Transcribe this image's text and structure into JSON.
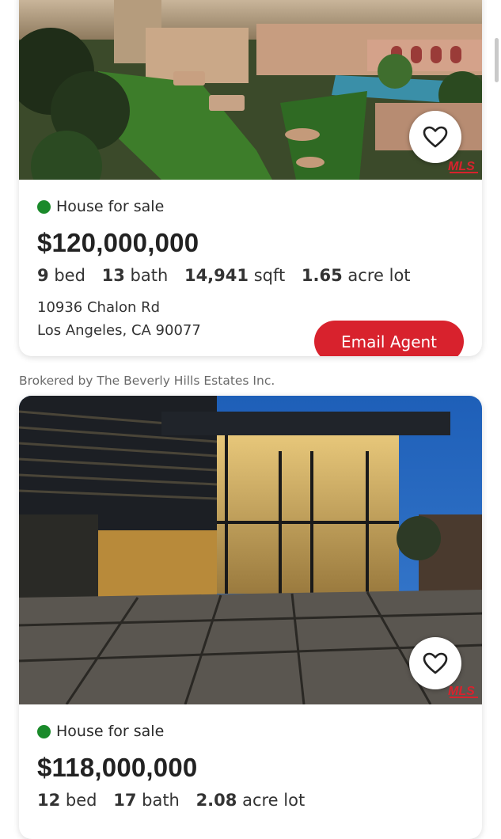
{
  "listings": [
    {
      "status": "House for sale",
      "price": "$120,000,000",
      "specs": [
        {
          "value": "9",
          "unit": "bed"
        },
        {
          "value": "13",
          "unit": "bath"
        },
        {
          "value": "14,941",
          "unit": "sqft"
        },
        {
          "value": "1.65",
          "unit": "acre lot"
        }
      ],
      "address_line1": "10936 Chalon Rd",
      "address_line2": "Los Angeles, CA 90077",
      "email_agent_label": "Email Agent",
      "broker": "Brokered by The Beverly Hills Estates Inc."
    },
    {
      "status": "House for sale",
      "price": "$118,000,000",
      "specs": [
        {
          "value": "12",
          "unit": "bed"
        },
        {
          "value": "17",
          "unit": "bath"
        },
        {
          "value": "2.08",
          "unit": "acre lot"
        }
      ]
    }
  ],
  "icons": {
    "favorite": "heart-outline-icon",
    "mls": "mls-logo",
    "status_dot": "green-dot"
  },
  "colors": {
    "accent": "#d8222d",
    "status_green": "#1a8a2a"
  }
}
